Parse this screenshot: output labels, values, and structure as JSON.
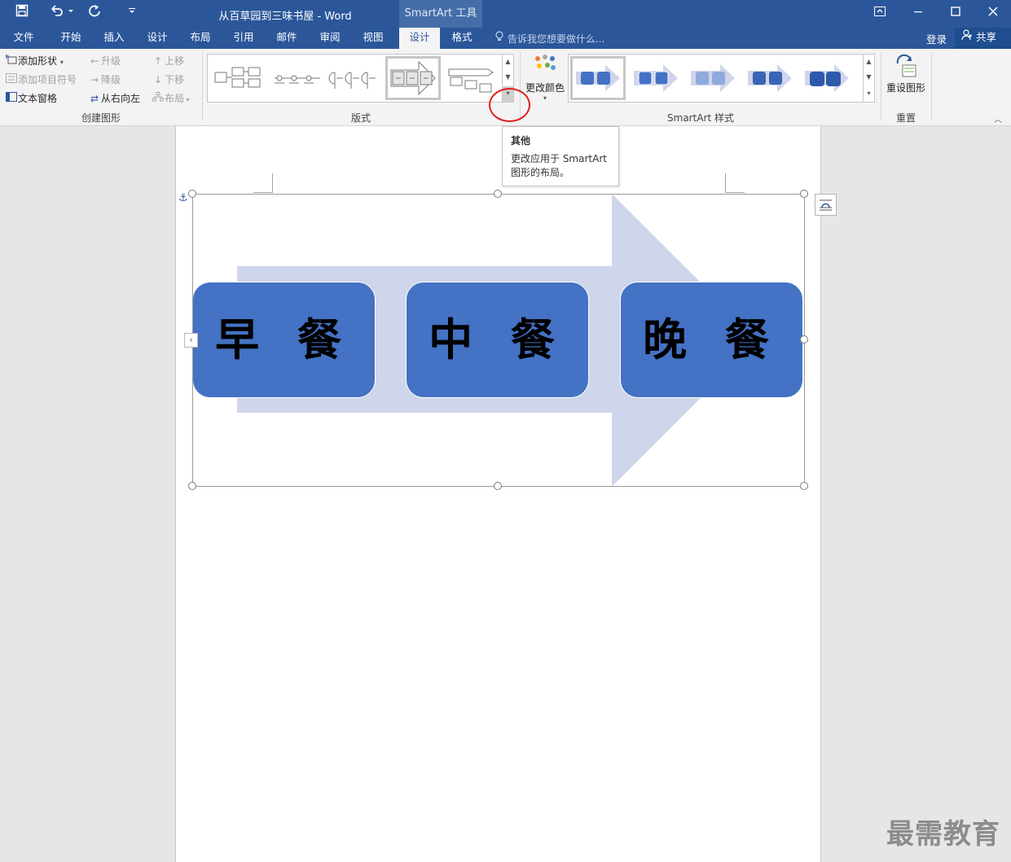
{
  "titlebar": {
    "doc_title": "从百草园到三味书屋 - Word",
    "context_tab": "SmartArt 工具",
    "qa_save_icon": "save-icon",
    "qa_undo_icon": "undo-icon",
    "qa_redo_icon": "redo-icon"
  },
  "tabs": {
    "items": [
      "文件",
      "开始",
      "插入",
      "设计",
      "布局",
      "引用",
      "邮件",
      "审阅",
      "视图",
      "设计",
      "格式"
    ],
    "active": "设计",
    "tell_me": "告诉我您想要做什么...",
    "login": "登录",
    "share": "共享"
  },
  "ribbon": {
    "create": {
      "add_shape": "添加形状",
      "add_bullet": "添加项目符号",
      "text_pane": "文本窗格",
      "promote": "升级",
      "demote": "降级",
      "right_to_left": "从右向左",
      "move_up": "上移",
      "move_down": "下移",
      "layout": "布局",
      "label": "创建图形"
    },
    "layouts": {
      "label": "版式"
    },
    "styles": {
      "change_colors": "更改颜色",
      "label": "SmartArt 样式"
    },
    "reset": {
      "reset_graphic": "重设图形",
      "label": "重置"
    }
  },
  "tooltip": {
    "title": "其他",
    "body": "更改应用于 SmartArt 图形的布局。"
  },
  "smartart": {
    "boxes": [
      "早 餐",
      "中 餐",
      "晚 餐"
    ],
    "box_color": "#4472c4",
    "arrow_color": "#cfd5ea"
  },
  "watermark": "最需教育",
  "colors": {
    "accent": "#2b579a",
    "highlight_circle": "#e02020"
  }
}
